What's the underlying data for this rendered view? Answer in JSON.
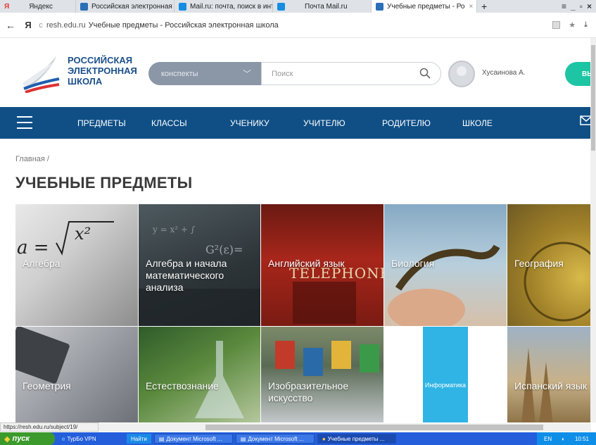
{
  "browser": {
    "tabs": [
      {
        "label": "Яндекс",
        "color": "#e53935"
      },
      {
        "label": "Российская электронная ш",
        "color": "#2a6fb8"
      },
      {
        "label": "Mail.ru: почта, поиск в инт",
        "color": "#168de2"
      },
      {
        "label": "Почта Mail.ru",
        "color": "#168de2"
      },
      {
        "label": "Учебные предметы - Ро",
        "color": "#2a6fb8"
      }
    ],
    "new_tab": "+",
    "ya_logo": "Я",
    "domain": "resh.edu.ru",
    "page_title": "Учебные предметы - Российская электронная школа",
    "status_url": "https://resh.edu.ru/subject/19/"
  },
  "site": {
    "logo_lines": [
      "РОССИЙСКАЯ",
      "ЭЛЕКТРОННАЯ",
      "ШКОЛА"
    ],
    "dropdown_value": "конспекты",
    "search_placeholder": "Поиск",
    "user_name": "Хусаинова А.",
    "login_label": "ВЫ",
    "nav": [
      "ПРЕДМЕТЫ",
      "КЛАССЫ",
      "УЧЕНИКУ",
      "УЧИТЕЛЮ",
      "РОДИТЕЛЮ",
      "ШКОЛЕ"
    ],
    "breadcrumb": "Главная  /",
    "page_heading": "УЧЕБНЫЕ ПРЕДМЕТЫ",
    "subjects": [
      {
        "label": "Алгебра"
      },
      {
        "label": "Алгебра и начала математического анализа"
      },
      {
        "label": "Английский язык"
      },
      {
        "label": "Биология"
      },
      {
        "label": "География"
      },
      {
        "label": "Геометрия"
      },
      {
        "label": "Естествознание"
      },
      {
        "label": "Изобразительное искусство"
      },
      {
        "label": "Информатика"
      },
      {
        "label": "Испанский язык"
      }
    ]
  },
  "taskbar": {
    "start": "пуск",
    "items": [
      "ТурБо VPN",
      "Найти",
      "Документ Microsoft ...",
      "Документ Microsoft ...",
      "Учебные предметы ..."
    ],
    "lang": "EN",
    "time": "10:51"
  },
  "colors": {
    "brand": "#0f4f86",
    "accent": "#1dc5a4"
  }
}
